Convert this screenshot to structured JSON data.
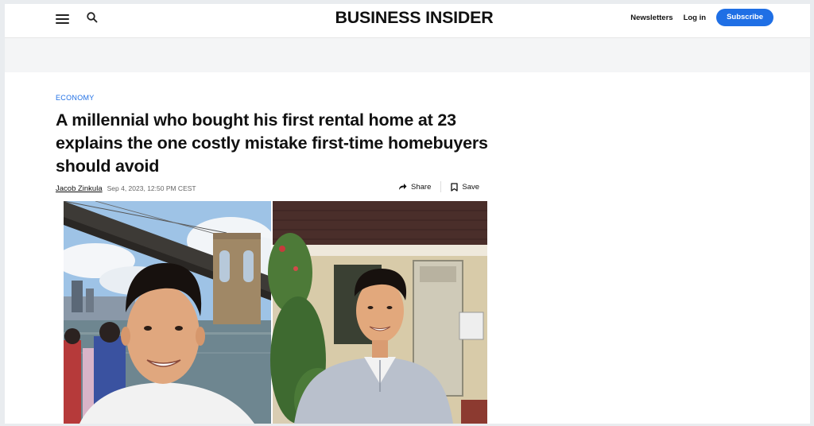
{
  "header": {
    "logo": "BUSINESS INSIDER",
    "newsletters_label": "Newsletters",
    "login_label": "Log in",
    "subscribe_label": "Subscribe",
    "menu_icon": "hamburger-menu-icon",
    "search_icon": "search-icon"
  },
  "article": {
    "category": "ECONOMY",
    "headline": "A millennial who bought his first rental home at 23 explains the one costly mistake first-time homebuyers should avoid",
    "author": "Jacob Zinkula",
    "date": "Sep 4, 2023, 12:50 PM CEST",
    "share_label": "Share",
    "save_label": "Save"
  },
  "colors": {
    "accent": "#1f6fe5",
    "text": "#111111",
    "muted": "#666666"
  }
}
